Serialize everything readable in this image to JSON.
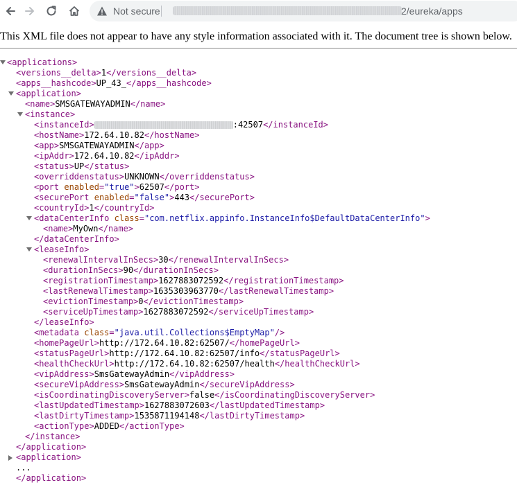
{
  "browser": {
    "status": "Not secure",
    "url_visible": "2/eureka/apps"
  },
  "banner": {
    "text": "This XML file does not appear to have any style information associated with it. The document tree is shown below."
  },
  "xml": {
    "root_tag": "applications",
    "versions_delta": {
      "tag": "versions__delta",
      "value": "1"
    },
    "apps_hashcode": {
      "tag": "apps__hashcode",
      "value": "UP_43_"
    },
    "application_tag": "application",
    "name": {
      "tag": "name",
      "value": "SMSGATEWAYADMIN"
    },
    "instance_tag": "instance",
    "instanceId": {
      "tag": "instanceId",
      "value_suffix": ":42507"
    },
    "hostName": {
      "tag": "hostName",
      "value": "172.64.10.82"
    },
    "app": {
      "tag": "app",
      "value": "SMSGATEWAYADMIN"
    },
    "ipAddr": {
      "tag": "ipAddr",
      "value": "172.64.10.82"
    },
    "status": {
      "tag": "status",
      "value": "UP"
    },
    "overriddenstatus": {
      "tag": "overriddenstatus",
      "value": "UNKNOWN"
    },
    "port": {
      "tag": "port",
      "attr": "enabled",
      "attr_value": "\"true\"",
      "value": "62507"
    },
    "securePort": {
      "tag": "securePort",
      "attr": "enabled",
      "attr_value": "\"false\"",
      "value": "443"
    },
    "countryId": {
      "tag": "countryId",
      "value": "1"
    },
    "dataCenterInfo": {
      "tag": "dataCenterInfo",
      "attr": "class",
      "attr_value": "\"com.netflix.appinfo.InstanceInfo$DefaultDataCenterInfo\""
    },
    "dc_name": {
      "tag": "name",
      "value": "MyOwn"
    },
    "leaseInfo_tag": "leaseInfo",
    "renewalIntervalInSecs": {
      "tag": "renewalIntervalInSecs",
      "value": "30"
    },
    "durationInSecs": {
      "tag": "durationInSecs",
      "value": "90"
    },
    "registrationTimestamp": {
      "tag": "registrationTimestamp",
      "value": "1627883072592"
    },
    "lastRenewalTimestamp": {
      "tag": "lastRenewalTimestamp",
      "value": "1635303963770"
    },
    "evictionTimestamp": {
      "tag": "evictionTimestamp",
      "value": "0"
    },
    "serviceUpTimestamp": {
      "tag": "serviceUpTimestamp",
      "value": "1627883072592"
    },
    "metadata": {
      "tag": "metadata",
      "attr": "class",
      "attr_value": "\"java.util.Collections$EmptyMap\""
    },
    "homePageUrl": {
      "tag": "homePageUrl",
      "value": "http://172.64.10.82:62507/"
    },
    "statusPageUrl": {
      "tag": "statusPageUrl",
      "value": "http://172.64.10.82:62507/info"
    },
    "healthCheckUrl": {
      "tag": "healthCheckUrl",
      "value": "http://172.64.10.82:62507/health"
    },
    "vipAddress": {
      "tag": "vipAddress",
      "value": "SmsGatewayAdmin"
    },
    "secureVipAddress": {
      "tag": "secureVipAddress",
      "value": "SmsGatewayAdmin"
    },
    "isCoordinatingDiscoveryServer": {
      "tag": "isCoordinatingDiscoveryServer",
      "value": "false"
    },
    "lastUpdatedTimestamp": {
      "tag": "lastUpdatedTimestamp",
      "value": "1627883072603"
    },
    "lastDirtyTimestamp": {
      "tag": "lastDirtyTimestamp",
      "value": "1535871194148"
    },
    "actionType": {
      "tag": "actionType",
      "value": "ADDED"
    },
    "ellipsis": "..."
  }
}
